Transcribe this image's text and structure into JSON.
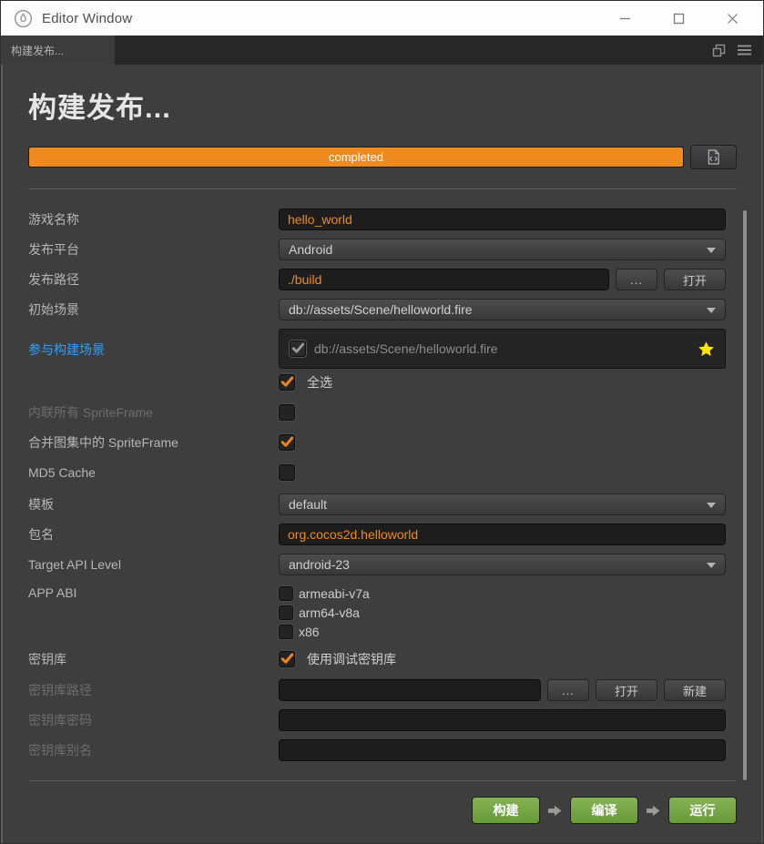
{
  "titlebar": {
    "title": "Editor Window"
  },
  "tabbar": {
    "active_tab": "构建发布..."
  },
  "main": {
    "heading": "构建发布...",
    "progress": {
      "status": "completed",
      "percent": 100
    }
  },
  "form": {
    "game_name": {
      "label": "游戏名称",
      "value": "hello_world"
    },
    "platform": {
      "label": "发布平台",
      "value": "Android"
    },
    "build_path": {
      "label": "发布路径",
      "value": "./build",
      "browse_label": "...",
      "open_label": "打开"
    },
    "start_scene": {
      "label": "初始场景",
      "value": "db://assets/Scene/helloworld.fire"
    },
    "scenes": {
      "label": "参与构建场景",
      "items": [
        {
          "path": "db://assets/Scene/helloworld.fire",
          "checked": true
        }
      ],
      "select_all_label": "全选",
      "select_all_checked": true
    },
    "inline_spriteframe": {
      "label": "内联所有 SpriteFrame",
      "checked": false
    },
    "merge_spriteframe": {
      "label": "合并图集中的 SpriteFrame",
      "checked": true
    },
    "md5_cache": {
      "label": "MD5 Cache",
      "checked": false
    },
    "template": {
      "label": "模板",
      "value": "default"
    },
    "package_name": {
      "label": "包名",
      "value": "org.cocos2d.helloworld"
    },
    "api_level": {
      "label": "Target API Level",
      "value": "android-23"
    },
    "app_abi": {
      "label": "APP ABI",
      "options": [
        {
          "label": "armeabi-v7a",
          "checked": false
        },
        {
          "label": "arm64-v8a",
          "checked": false
        },
        {
          "label": "x86",
          "checked": false
        }
      ]
    },
    "keystore": {
      "label": "密钥库",
      "checkbox_label": "使用调试密钥库",
      "checked": true
    },
    "keystore_path": {
      "label": "密钥库路径",
      "value": "",
      "browse_label": "...",
      "open_label": "打开",
      "new_label": "新建"
    },
    "keystore_password": {
      "label": "密钥库密码",
      "value": ""
    },
    "keystore_alias": {
      "label": "密钥库别名",
      "value": ""
    }
  },
  "footer": {
    "build_label": "构建",
    "compile_label": "编译",
    "run_label": "运行"
  },
  "colors": {
    "accent_orange": "#ef8a1e",
    "link_blue": "#2e9fff",
    "button_green": "#74a444",
    "star_yellow": "#ffe600",
    "titlebar_bg": "#fdfdfd",
    "panel_bg": "#3e3e3e"
  },
  "icons": {
    "app_logo": "cocos-creator-logo",
    "window_controls": [
      "minimize",
      "maximize",
      "close"
    ],
    "tabbar_icons": [
      "popout-window",
      "menu"
    ],
    "progress_button": "open-log-file",
    "scene_favorite": "star",
    "dropdown": "caret-down",
    "checkbox_check": "check",
    "footer_arrow": "arrow-right"
  }
}
